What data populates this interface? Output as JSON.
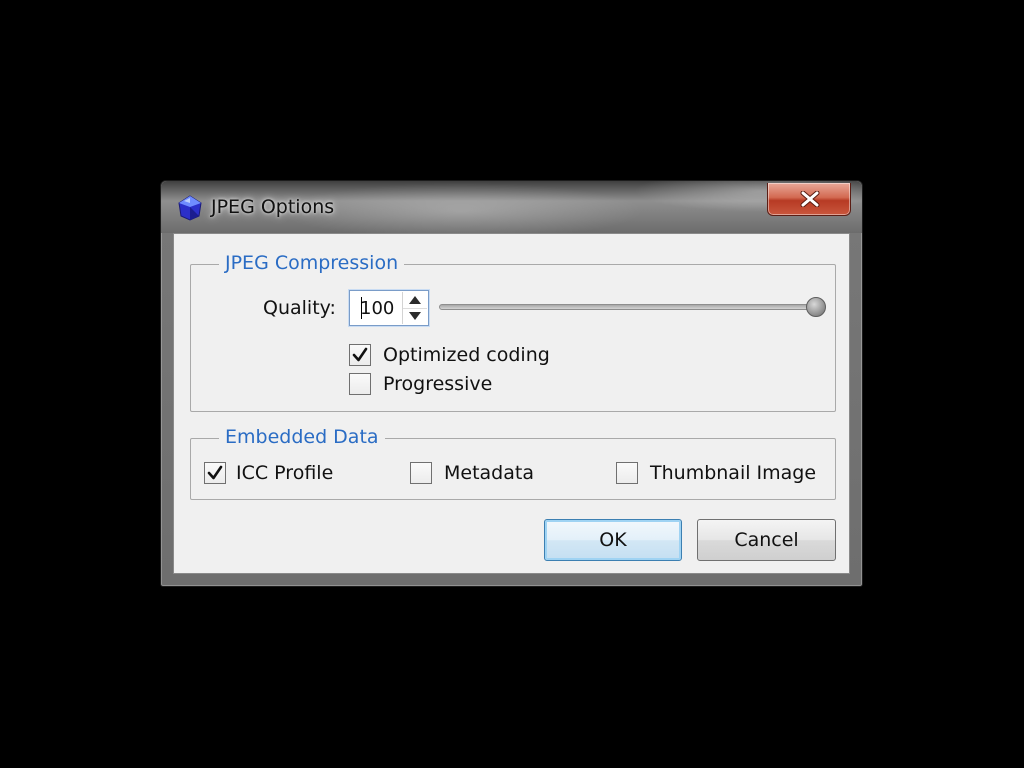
{
  "window": {
    "title": "JPEG Options",
    "app_icon": "gem-icon",
    "close_icon": "close-icon"
  },
  "compression": {
    "legend": "JPEG Compression",
    "quality_label": "Quality:",
    "quality_value": "100",
    "quality_slider_value": 100,
    "quality_slider_max": 100,
    "optimized_coding": {
      "label": "Optimized coding",
      "checked": true
    },
    "progressive": {
      "label": "Progressive",
      "checked": false
    }
  },
  "embedded": {
    "legend": "Embedded Data",
    "icc_profile": {
      "label": "ICC Profile",
      "checked": true
    },
    "metadata": {
      "label": "Metadata",
      "checked": false
    },
    "thumbnail": {
      "label": "Thumbnail Image",
      "checked": false
    }
  },
  "buttons": {
    "ok": "OK",
    "cancel": "Cancel"
  },
  "colors": {
    "legend_text": "#2a6cc4",
    "close_button": "#c9573d",
    "default_button_border": "#3c7fb1"
  }
}
